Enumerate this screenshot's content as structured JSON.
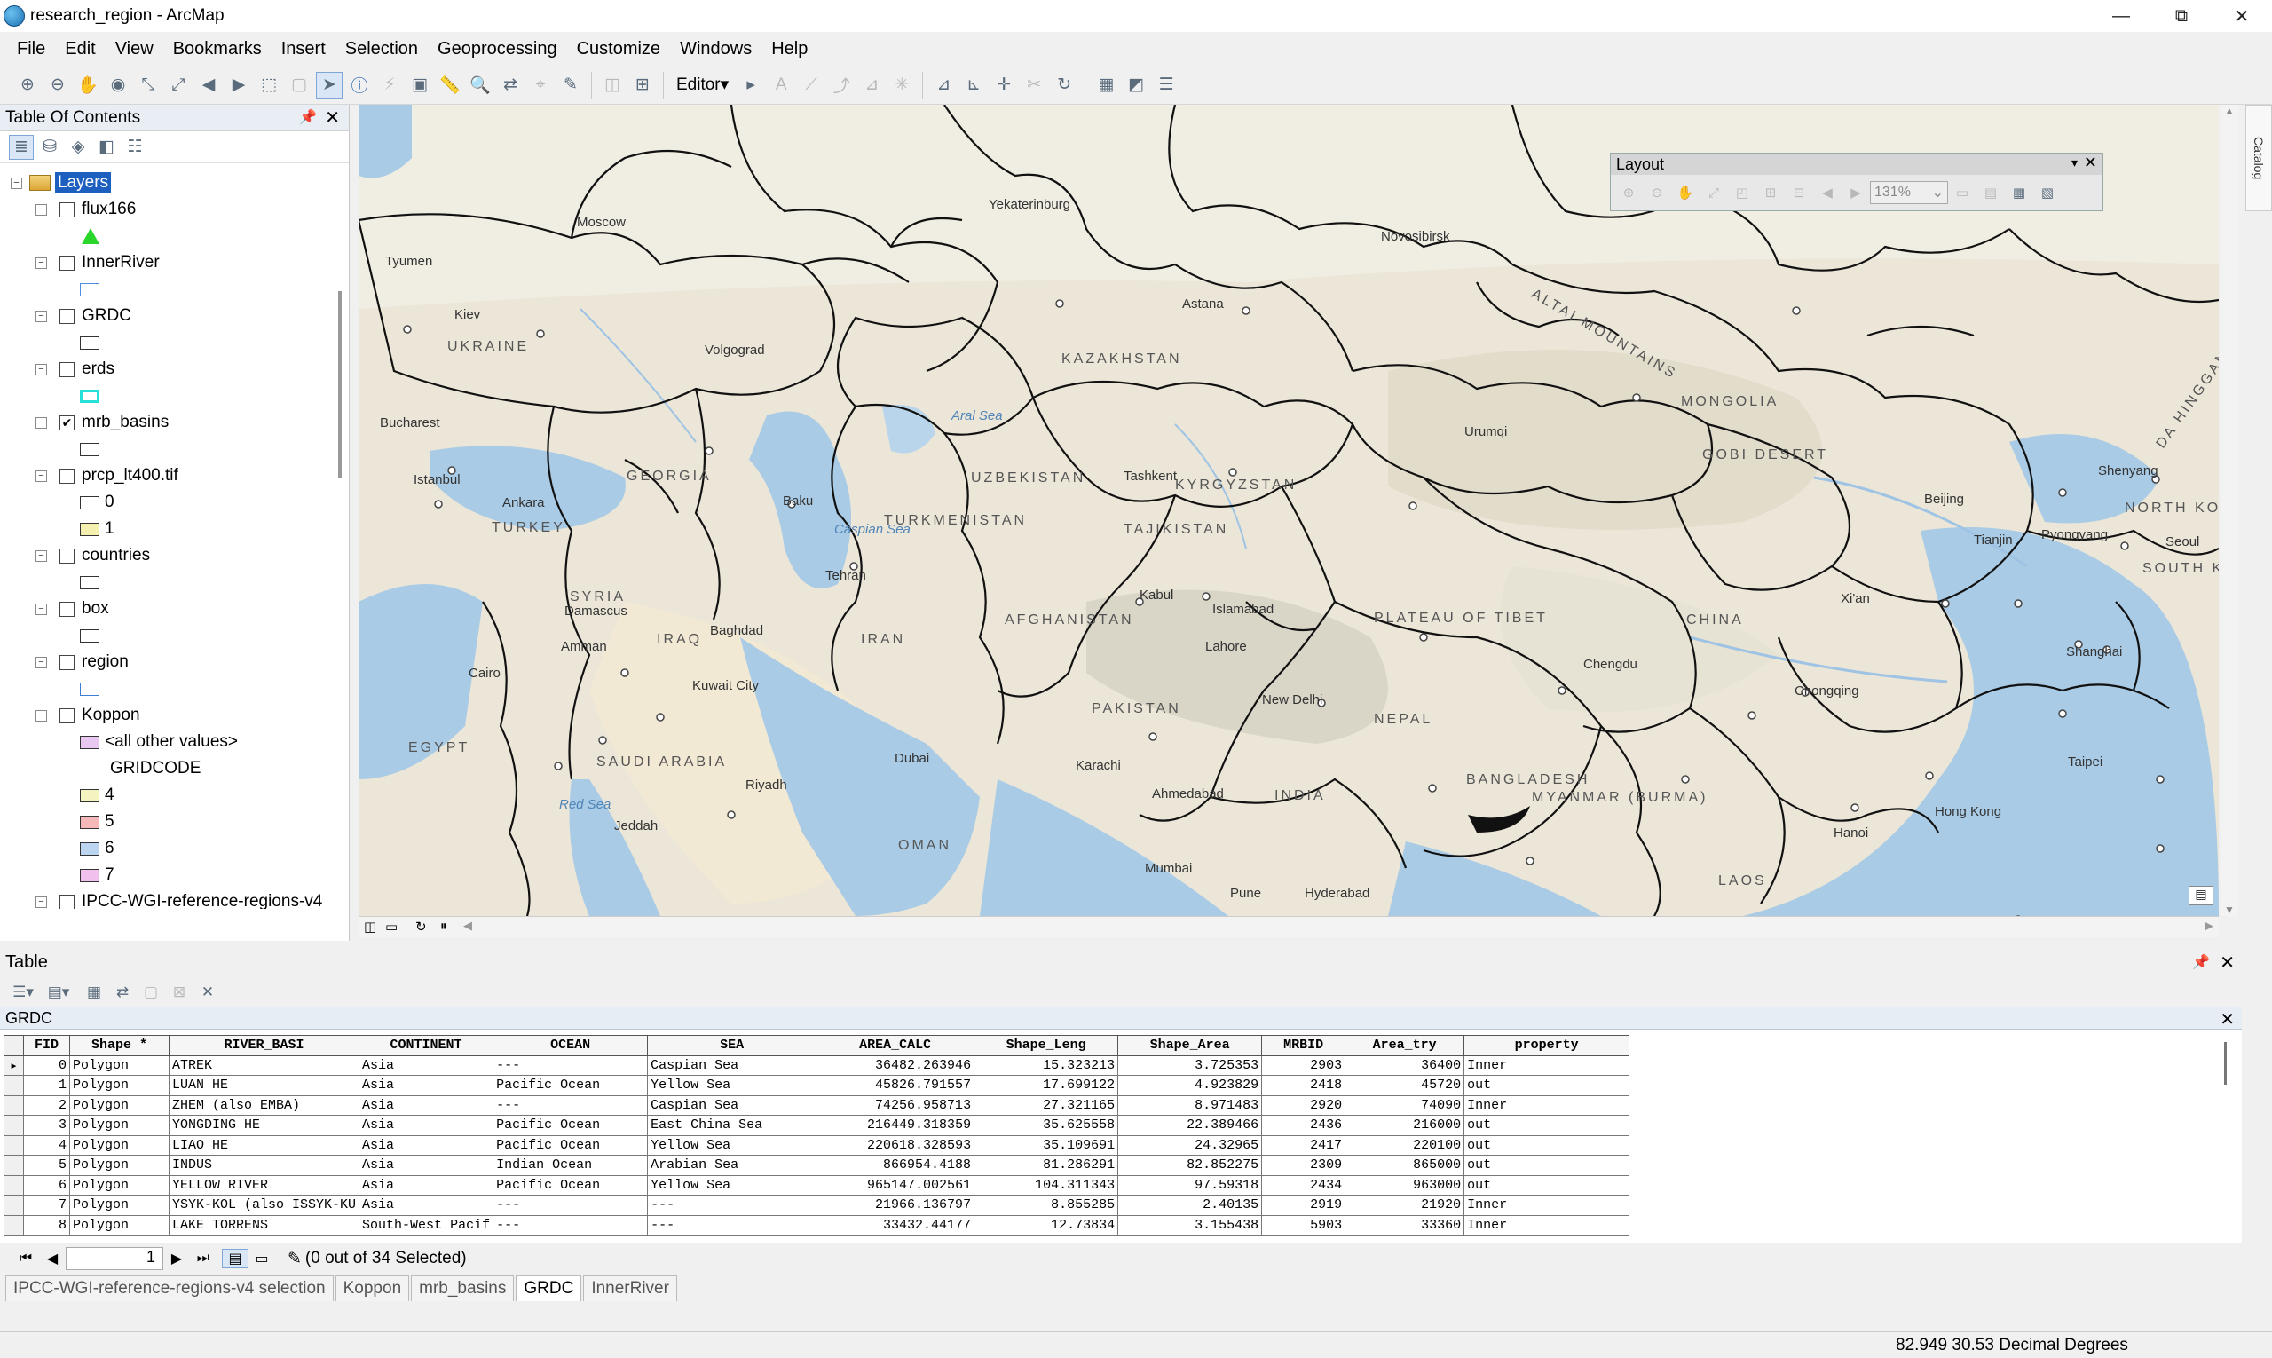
{
  "window": {
    "title": "research_region - ArcMap",
    "min": "—",
    "max": "⧉",
    "close": "✕"
  },
  "menu": [
    "File",
    "Edit",
    "View",
    "Bookmarks",
    "Insert",
    "Selection",
    "Geoprocessing",
    "Customize",
    "Windows",
    "Help"
  ],
  "toolbar": {
    "editor_label": "Editor▾"
  },
  "toc": {
    "title": "Table Of Contents",
    "root": "Layers",
    "layers": [
      {
        "name": "flux166",
        "checked": false,
        "symbol": "triangle-green"
      },
      {
        "name": "InnerRiver",
        "checked": false,
        "symbol": "box-blue"
      },
      {
        "name": "GRDC",
        "checked": false,
        "symbol": "box-black"
      },
      {
        "name": "erds",
        "checked": false,
        "symbol": "box-cyan"
      },
      {
        "name": "mrb_basins",
        "checked": true,
        "symbol": "box-black"
      },
      {
        "name": "prcp_lt400.tif",
        "checked": false,
        "classes": [
          {
            "label": "0",
            "color": "#ffffff"
          },
          {
            "label": "1",
            "color": "#f5efb0"
          }
        ]
      },
      {
        "name": "countries",
        "checked": false,
        "symbol": "box-black"
      },
      {
        "name": "box",
        "checked": false,
        "symbol": "box-black"
      },
      {
        "name": "region",
        "checked": false,
        "symbol": "box-blue"
      },
      {
        "name": "Koppon",
        "checked": false,
        "classes": [
          {
            "label": "<all other values>",
            "color": "#e8c8f0"
          },
          {
            "label": "GRIDCODE",
            "color": ""
          },
          {
            "label": "4",
            "color": "#f4f4c0"
          },
          {
            "label": "5",
            "color": "#f6b8b8"
          },
          {
            "label": "6",
            "color": "#bcd6f2"
          },
          {
            "label": "7",
            "color": "#f2c0ec"
          }
        ]
      },
      {
        "name": "IPCC-WGI-reference-regions-v4",
        "checked": false
      }
    ]
  },
  "layout_toolbar": {
    "title": "Layout",
    "zoom": "131%"
  },
  "map": {
    "labels": [
      {
        "t": "Moscow",
        "c": "city"
      },
      {
        "t": "Yekaterinburg",
        "c": "city"
      },
      {
        "t": "Novosibirsk",
        "c": "city"
      },
      {
        "t": "Astana",
        "c": "city"
      },
      {
        "t": "Kiev",
        "c": "city"
      },
      {
        "t": "Volgograd",
        "c": "city"
      },
      {
        "t": "KAZAKHSTAN",
        "c": "country"
      },
      {
        "t": "MONGOLIA",
        "c": "country"
      },
      {
        "t": "GOBI DESERT",
        "c": "country"
      },
      {
        "t": "Urumqi",
        "c": "city"
      },
      {
        "t": "Bucharest",
        "c": "city"
      },
      {
        "t": "Istanbul",
        "c": "city"
      },
      {
        "t": "Ankara",
        "c": "city"
      },
      {
        "t": "TURKEY",
        "c": "country"
      },
      {
        "t": "GEORGIA",
        "c": "country"
      },
      {
        "t": "Baku",
        "c": "city"
      },
      {
        "t": "Caspian Sea",
        "c": "sea"
      },
      {
        "t": "Aral Sea",
        "c": "sea"
      },
      {
        "t": "UZBEKISTAN",
        "c": "country"
      },
      {
        "t": "TURKMENISTAN",
        "c": "country"
      },
      {
        "t": "Tashkent",
        "c": "city"
      },
      {
        "t": "KYRGYZSTAN",
        "c": "country"
      },
      {
        "t": "TAJIKISTAN",
        "c": "country"
      },
      {
        "t": "Tehran",
        "c": "city"
      },
      {
        "t": "Kabul",
        "c": "city"
      },
      {
        "t": "Islamabad",
        "c": "city"
      },
      {
        "t": "Lahore",
        "c": "city"
      },
      {
        "t": "IRAN",
        "c": "country"
      },
      {
        "t": "IRAQ",
        "c": "country"
      },
      {
        "t": "Baghdad",
        "c": "city"
      },
      {
        "t": "SYRIA",
        "c": "country"
      },
      {
        "t": "Damascus",
        "c": "city"
      },
      {
        "t": "Amman",
        "c": "city"
      },
      {
        "t": "Cairo",
        "c": "city"
      },
      {
        "t": "EGYPT",
        "c": "country"
      },
      {
        "t": "Kuwait City",
        "c": "city"
      },
      {
        "t": "SAUDI ARABIA",
        "c": "country"
      },
      {
        "t": "Riyadh",
        "c": "city"
      },
      {
        "t": "Jeddah",
        "c": "city"
      },
      {
        "t": "Dubai",
        "c": "city"
      },
      {
        "t": "OMAN",
        "c": "country"
      },
      {
        "t": "Karachi",
        "c": "city"
      },
      {
        "t": "PAKISTAN",
        "c": "country"
      },
      {
        "t": "AFGHANISTAN",
        "c": "country"
      },
      {
        "t": "New Delhi",
        "c": "city"
      },
      {
        "t": "NEPAL",
        "c": "country"
      },
      {
        "t": "INDIA",
        "c": "country"
      },
      {
        "t": "Ahmedabad",
        "c": "city"
      },
      {
        "t": "Mumbai",
        "c": "city"
      },
      {
        "t": "Hyderabad",
        "c": "city"
      },
      {
        "t": "Pune",
        "c": "city"
      },
      {
        "t": "PLATEAU OF TIBET",
        "c": "country"
      },
      {
        "t": "CHINA",
        "c": "country"
      },
      {
        "t": "Chengdu",
        "c": "city"
      },
      {
        "t": "Chongqing",
        "c": "city"
      },
      {
        "t": "Xi'an",
        "c": "city"
      },
      {
        "t": "Beijing",
        "c": "city"
      },
      {
        "t": "Tianjin",
        "c": "city"
      },
      {
        "t": "Pyongyang",
        "c": "city"
      },
      {
        "t": "Seoul",
        "c": "city"
      },
      {
        "t": "Shenyang",
        "c": "city"
      },
      {
        "t": "Shanghai",
        "c": "city"
      },
      {
        "t": "Taipei",
        "c": "city"
      },
      {
        "t": "Hong Kong",
        "c": "city"
      },
      {
        "t": "Hanoi",
        "c": "city"
      },
      {
        "t": "BANGLADESH",
        "c": "country"
      },
      {
        "t": "MYANMAR (BURMA)",
        "c": "country"
      },
      {
        "t": "LAOS",
        "c": "country"
      },
      {
        "t": "Red Sea",
        "c": "sea"
      },
      {
        "t": "ALTAI MOUNTAINS",
        "c": "country"
      },
      {
        "t": "UKRAINE",
        "c": "country"
      },
      {
        "t": "NORTH KOREA",
        "c": "country"
      },
      {
        "t": "SOUTH KOREA",
        "c": "country"
      },
      {
        "t": "DA HINGGAN LING",
        "c": "country"
      },
      {
        "t": "Tyumen",
        "c": "city"
      }
    ]
  },
  "table": {
    "title": "Table",
    "name": "GRDC",
    "columns": [
      "FID",
      "Shape *",
      "RIVER_BASI",
      "CONTINENT",
      "OCEAN",
      "SEA",
      "AREA_CALC",
      "Shape_Leng",
      "Shape_Area",
      "MRBID",
      "Area_try",
      "property"
    ],
    "rows": [
      [
        "0",
        "Polygon",
        "ATREK",
        "Asia",
        "---",
        "Caspian Sea",
        "36482.263946",
        "15.323213",
        "3.725353",
        "2903",
        "36400",
        "Inner"
      ],
      [
        "1",
        "Polygon",
        "LUAN HE",
        "Asia",
        "Pacific Ocean",
        "Yellow Sea",
        "45826.791557",
        "17.699122",
        "4.923829",
        "2418",
        "45720",
        "out"
      ],
      [
        "2",
        "Polygon",
        "ZHEM (also EMBA)",
        "Asia",
        "---",
        "Caspian Sea",
        "74256.958713",
        "27.321165",
        "8.971483",
        "2920",
        "74090",
        "Inner"
      ],
      [
        "3",
        "Polygon",
        "YONGDING HE",
        "Asia",
        "Pacific Ocean",
        "East China Sea",
        "216449.318359",
        "35.625558",
        "22.389466",
        "2436",
        "216000",
        "out"
      ],
      [
        "4",
        "Polygon",
        "LIAO HE",
        "Asia",
        "Pacific Ocean",
        "Yellow Sea",
        "220618.328593",
        "35.109691",
        "24.32965",
        "2417",
        "220100",
        "out"
      ],
      [
        "5",
        "Polygon",
        "INDUS",
        "Asia",
        "Indian Ocean",
        "Arabian Sea",
        "866954.4188",
        "81.286291",
        "82.852275",
        "2309",
        "865000",
        "out"
      ],
      [
        "6",
        "Polygon",
        "YELLOW RIVER",
        "Asia",
        "Pacific Ocean",
        "Yellow Sea",
        "965147.002561",
        "104.311343",
        "97.59318",
        "2434",
        "963000",
        "out"
      ],
      [
        "7",
        "Polygon",
        "YSYK-KOL (also ISSYK-KU",
        "Asia",
        "---",
        "---",
        "21966.136797",
        "8.855285",
        "2.40135",
        "2919",
        "21920",
        "Inner"
      ],
      [
        "8",
        "Polygon",
        "LAKE TORRENS",
        "South-West Pacif",
        "---",
        "---",
        "33432.44177",
        "12.73834",
        "3.155438",
        "5903",
        "33360",
        "Inner"
      ]
    ],
    "page": "1",
    "selection": "(0 out of 34 Selected)",
    "tabs": [
      "IPCC-WGI-reference-regions-v4 selection",
      "Koppon",
      "mrb_basins",
      "GRDC",
      "InnerRiver"
    ],
    "active_tab": "GRDC"
  },
  "status": {
    "coords": "82.949  30.53 Decimal Degrees"
  }
}
